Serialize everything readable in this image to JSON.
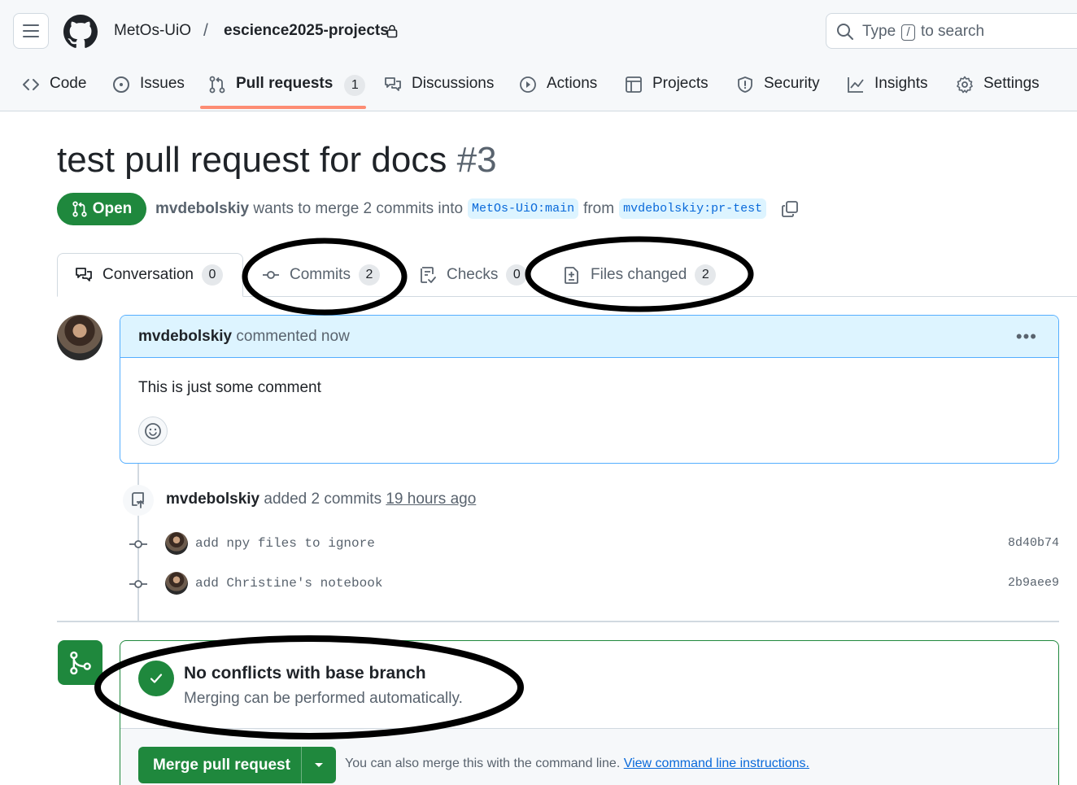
{
  "header": {
    "owner": "MetOs-UiO",
    "separator": "/",
    "repo": "escience2025-projects",
    "search": {
      "prefix": "Type",
      "key": "/",
      "suffix": "to search"
    }
  },
  "nav": {
    "code": "Code",
    "issues": "Issues",
    "pull_requests": "Pull requests",
    "pull_requests_count": "1",
    "discussions": "Discussions",
    "actions": "Actions",
    "projects": "Projects",
    "security": "Security",
    "insights": "Insights",
    "settings": "Settings"
  },
  "pr": {
    "title": "test pull request for docs",
    "number": "#3",
    "state": "Open",
    "author": "mvdebolskiy",
    "merge_text": "wants to merge 2 commits into",
    "base_branch": "MetOs-UiO:main",
    "from_text": "from",
    "head_branch": "mvdebolskiy:pr-test"
  },
  "tabs": {
    "conversation": "Conversation",
    "conversation_count": "0",
    "commits": "Commits",
    "commits_count": "2",
    "checks": "Checks",
    "checks_count": "0",
    "files_changed": "Files changed",
    "files_changed_count": "2"
  },
  "comment": {
    "author": "mvdebolskiy",
    "action": "commented now",
    "more": "•••",
    "body": "This is just some comment"
  },
  "timeline": {
    "author": "mvdebolskiy",
    "action": "added 2 commits",
    "time": "19 hours ago",
    "commits": [
      {
        "message": "add npy files to ignore",
        "sha": "8d40b74"
      },
      {
        "message": "add Christine's notebook",
        "sha": "2b9aee9"
      }
    ]
  },
  "merge": {
    "title": "No conflicts with base branch",
    "subtitle": "Merging can be performed automatically.",
    "button": "Merge pull request",
    "hint": "You can also merge this with the command line.",
    "hint_link": "View command line instructions."
  },
  "colors": {
    "success": "#1f883d",
    "accent": "#0969da",
    "nav_underline": "#fd8c73",
    "comment_header": "#ddf4ff"
  }
}
